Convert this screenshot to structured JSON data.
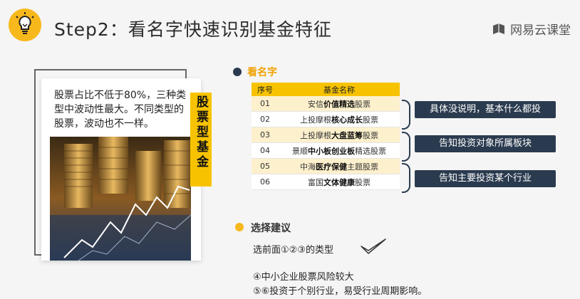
{
  "header": {
    "title": "Step2：看名字快速识别基金特征",
    "brand": "网易云课堂"
  },
  "left_card": {
    "text": "股票占比不低于80%，三种类型中波动性最大。不同类型的股票，波动也不一样。",
    "tag": "股票型基金"
  },
  "section1": {
    "label": "看名字"
  },
  "table": {
    "headers": [
      "序号",
      "基金名称"
    ],
    "rows": [
      {
        "num": "01",
        "pre": "安信",
        "key": "价值精选",
        "post": "股票"
      },
      {
        "num": "02",
        "pre": "上投摩根",
        "key": "核心成长",
        "post": "股票"
      },
      {
        "num": "03",
        "pre": "上投摩根",
        "key": "大盘蓝筹",
        "post": "股票"
      },
      {
        "num": "04",
        "pre": "景顺",
        "key": "中小板创业板",
        "post": "精选股票"
      },
      {
        "num": "05",
        "pre": "中海",
        "key": "医疗保健",
        "post": "主题股票"
      },
      {
        "num": "06",
        "pre": "富国",
        "key": "文体健康",
        "post": "股票"
      }
    ]
  },
  "callouts": [
    "具体没说明，基本什么都投",
    "告知投资对象所属板块",
    "告知主要投资某个行业"
  ],
  "section2": {
    "label": "选择建议"
  },
  "advice": {
    "line1": "选前面①②③的类型",
    "line2": "④中小企业股票风险较大",
    "line3": "⑤⑥投资于个别行业，易受行业周期影响。"
  },
  "colors": {
    "accent": "#f7c300",
    "navy": "#2b3b4f",
    "highlight_row": "#fdf0cc"
  },
  "icons": {
    "logo": "lightbulb-icon",
    "brand": "book-icon",
    "check": "checkmark-icon"
  }
}
